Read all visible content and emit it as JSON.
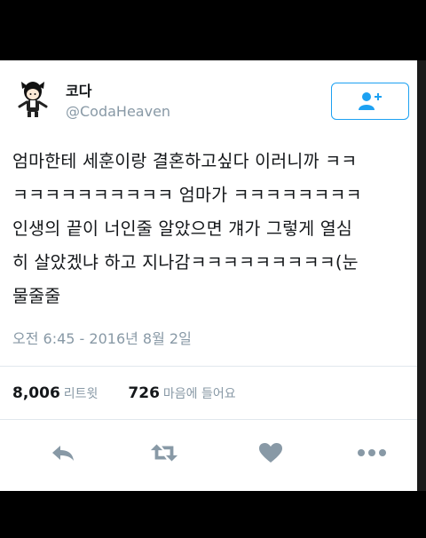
{
  "tweet": {
    "display_name": "코다",
    "handle": "@CodaHeaven",
    "text_lines": [
      "엄마한테 세훈이랑 결혼하고싶다 이러니까 ㅋㅋ",
      "ㅋㅋㅋㅋㅋㅋㅋㅋㅋㅋ 엄마가 ㅋㅋㅋㅋㅋㅋㅋㅋ",
      "인생의 끝이 너인줄 알았으면 걔가 그렇게 열심",
      "히 살았겠냐 하고 지나감ㅋㅋㅋㅋㅋㅋㅋㅋㅋ(눈",
      "물줄줄"
    ],
    "timestamp": "오전 6:45 - 2016년 8월 2일",
    "retweet_count": "8,006",
    "retweet_label": "리트윗",
    "like_count": "726",
    "like_label": "마음에 들어요"
  },
  "icons": {
    "follow": "add-user-icon",
    "reply": "reply-icon",
    "retweet": "retweet-icon",
    "like": "heart-icon",
    "more": "more-icon"
  },
  "colors": {
    "accent": "#1da1f2",
    "muted": "#8899a6",
    "text": "#14171a"
  }
}
